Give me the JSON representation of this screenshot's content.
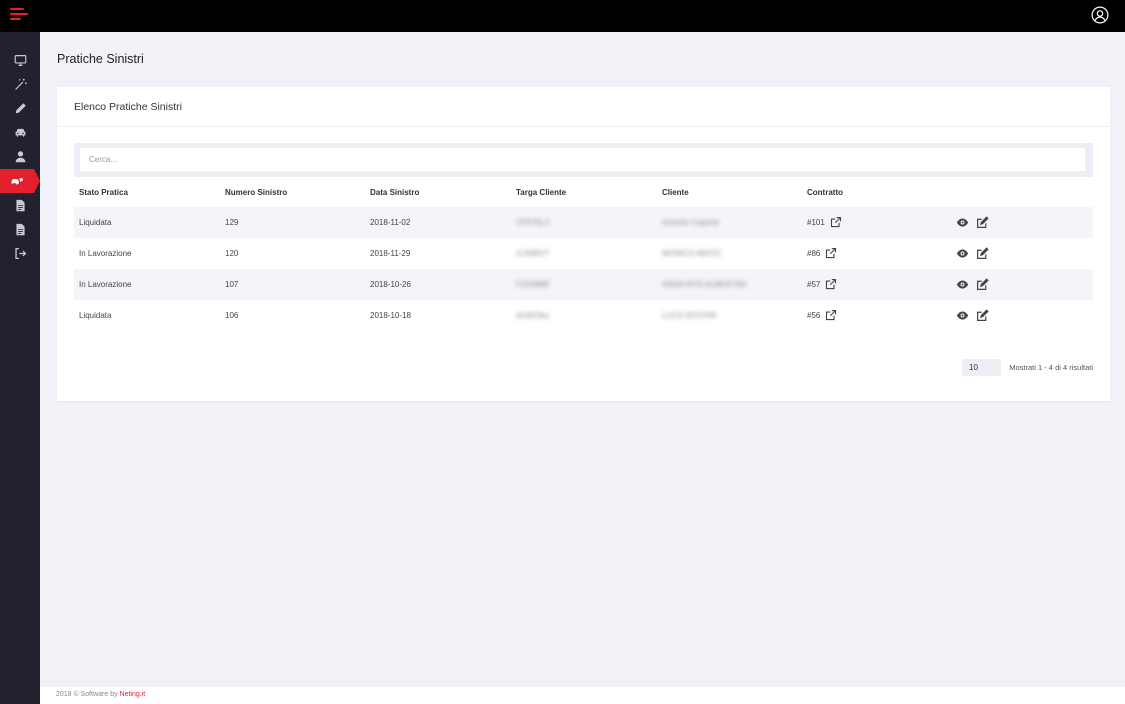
{
  "page_title": "Pratiche Sinistri",
  "card_title": "Elenco Pratiche Sinistri",
  "search": {
    "placeholder": "Cerca..."
  },
  "table": {
    "headers": [
      "Stato Pratica",
      "Numero Sinistro",
      "Data Sinistro",
      "Targa Cliente",
      "Cliente",
      "Contratto"
    ],
    "rows": [
      {
        "stato": "Liquidata",
        "numero": "129",
        "data": "2018-11-02",
        "targa": "CF976LX",
        "cliente": "Antonio Capone",
        "contratto": "#101"
      },
      {
        "stato": "In Lavorazione",
        "numero": "120",
        "data": "2018-11-29",
        "targa": "GJ598VT",
        "cliente": "MONICA ABATE",
        "contratto": "#86"
      },
      {
        "stato": "In Lavorazione",
        "numero": "107",
        "data": "2018-10-26",
        "targa": "FZ058MF",
        "cliente": "ANNA RITA ALBERTINI",
        "contratto": "#57"
      },
      {
        "stato": "Liquidata",
        "numero": "106",
        "data": "2018-10-18",
        "targa": "dm823ka",
        "cliente": "LUCA SOVONI",
        "contratto": "#56"
      }
    ]
  },
  "pagination": {
    "page_size": "10",
    "info": "Mostrati 1 - 4 di 4 risultati"
  },
  "footer": {
    "text": "2018 © Software by ",
    "link": "Neting.it"
  },
  "colors": {
    "accent": "#e4202e",
    "sidebar": "#22222f",
    "topbar": "#000000",
    "background": "#f1f2f7"
  },
  "sidebar_icons": [
    "monitor-icon",
    "magic-wand-icon",
    "pencil-icon",
    "car-icon",
    "user-icon",
    "car-crash-icon",
    "document-icon",
    "document-icon",
    "logout-icon"
  ]
}
